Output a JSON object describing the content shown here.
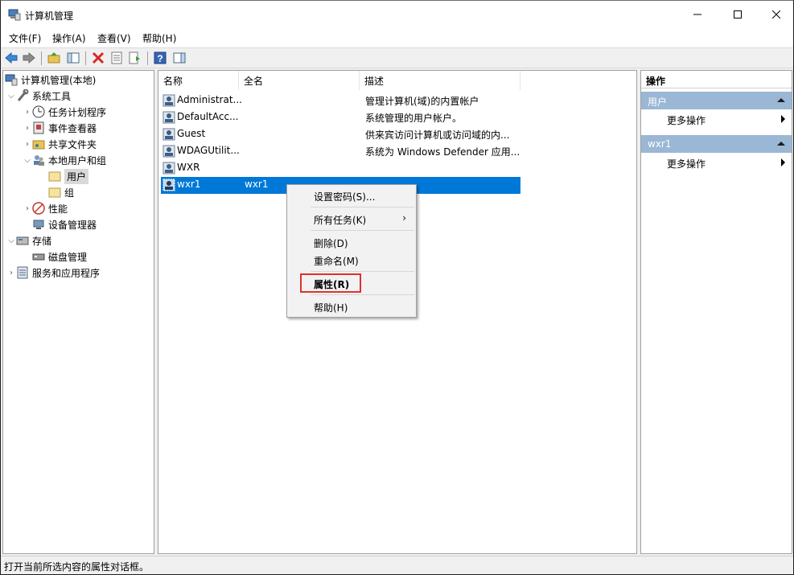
{
  "window": {
    "title": "计算机管理"
  },
  "menubar": [
    "文件(F)",
    "操作(A)",
    "查看(V)",
    "帮助(H)"
  ],
  "tree": {
    "root": "计算机管理(本地)",
    "system_tools": "系统工具",
    "task_scheduler": "任务计划程序",
    "event_viewer": "事件查看器",
    "shared_folders": "共享文件夹",
    "local_users_groups": "本地用户和组",
    "users": "用户",
    "groups": "组",
    "performance": "性能",
    "device_manager": "设备管理器",
    "storage": "存储",
    "disk_management": "磁盘管理",
    "services_apps": "服务和应用程序"
  },
  "list": {
    "columns": [
      "名称",
      "全名",
      "描述"
    ],
    "rows": [
      {
        "name": "Administrat...",
        "fullname": "",
        "desc": "管理计算机(域)的内置帐户"
      },
      {
        "name": "DefaultAcc...",
        "fullname": "",
        "desc": "系统管理的用户帐户。"
      },
      {
        "name": "Guest",
        "fullname": "",
        "desc": "供来宾访问计算机或访问域的内..."
      },
      {
        "name": "WDAGUtilit...",
        "fullname": "",
        "desc": "系统为 Windows Defender 应用..."
      },
      {
        "name": "WXR",
        "fullname": "",
        "desc": ""
      },
      {
        "name": "wxr1",
        "fullname": "wxr1",
        "desc": ""
      }
    ]
  },
  "actions": {
    "title": "操作",
    "section1": "用户",
    "section1_more": "更多操作",
    "section2": "wxr1",
    "section2_more": "更多操作"
  },
  "context_menu": {
    "set_password": "设置密码(S)...",
    "all_tasks": "所有任务(K)",
    "delete": "删除(D)",
    "rename": "重命名(M)",
    "properties": "属性(R)",
    "help": "帮助(H)"
  },
  "status": "打开当前所选内容的属性对话框。",
  "colors": {
    "selection": "#0078d7",
    "action_header": "#9ab7d5",
    "highlight_box": "#e0302c"
  }
}
